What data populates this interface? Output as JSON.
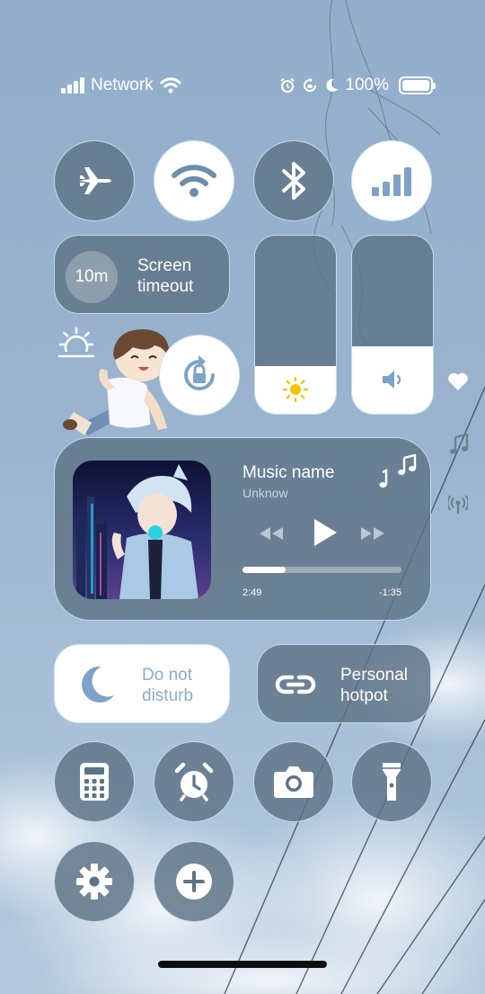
{
  "status_bar": {
    "network": "Network",
    "battery": "100%"
  },
  "tiles": {
    "screen_timeout": {
      "badge": "10m",
      "label_line1": "Screen",
      "label_line2": "timeout"
    },
    "do_not_disturb": {
      "label_line1": "Do not",
      "label_line2": "disturb"
    },
    "personal_hotspot": {
      "label_line1": "Personal",
      "label_line2": "hotpot"
    }
  },
  "sliders": {
    "brightness": 0.27,
    "volume": 0.38
  },
  "music": {
    "title": "Music name",
    "artist": "Unknow",
    "elapsed": "2:49",
    "remaining": "-1:35",
    "progress": 0.27
  },
  "colors": {
    "tile_dark": "#5e7385",
    "tile_light": "#ffffff",
    "accent": "#7da3c6",
    "sun": "#f7c300",
    "outline": "#cde4f5"
  }
}
